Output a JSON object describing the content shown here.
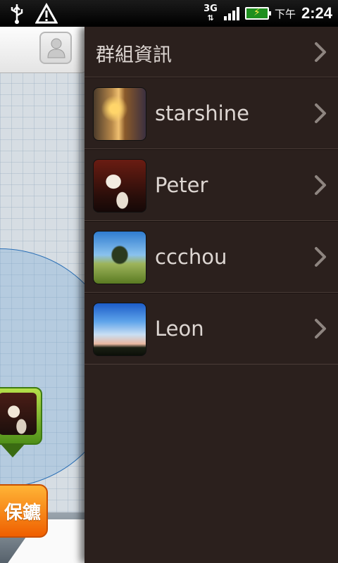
{
  "status_bar": {
    "network_type": "3G",
    "time_prefix": "下午",
    "time": "2:24",
    "icons": [
      "usb-icon",
      "warning-icon",
      "3g-data-icon",
      "signal-icon",
      "battery-charging-icon"
    ],
    "battery_color": "#1f8f1f"
  },
  "background_app": {
    "bodyguard_button_label": "保鑣",
    "accent_color": "#ef5f00",
    "pin_color": "#6fb024",
    "range_circle_color": "#2a6fb5"
  },
  "panel": {
    "header_title": "群組資訊",
    "background_color": "#2b201d",
    "members": [
      {
        "name": "starshine",
        "photo": "starshine-photo"
      },
      {
        "name": "Peter",
        "photo": "peter-photo"
      },
      {
        "name": "ccchou",
        "photo": "ccchou-photo"
      },
      {
        "name": "Leon",
        "photo": "leon-photo"
      }
    ]
  }
}
